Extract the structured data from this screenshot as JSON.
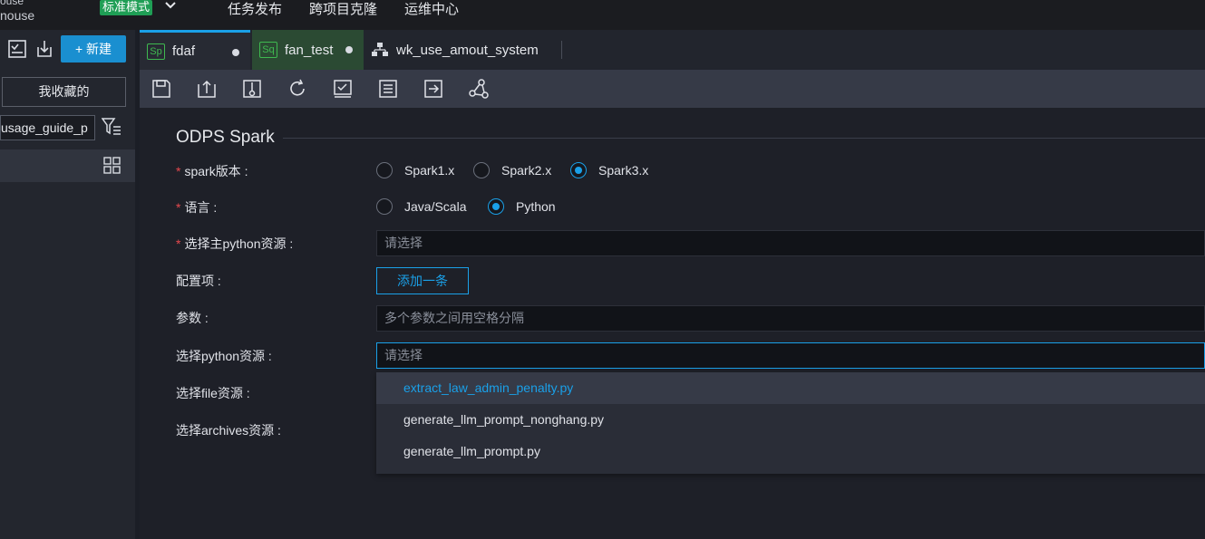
{
  "header": {
    "workspace_partial_top": "ouse",
    "workspace_partial": "nouse",
    "mode_badge": "标准模式",
    "nav": [
      "任务发布",
      "跨项目克隆",
      "运维中心"
    ]
  },
  "sidebar": {
    "new_button": "+ 新建",
    "favorites_button": "我收藏的",
    "search_value": "usage_guide_p"
  },
  "tabs": [
    {
      "tag": "Sp",
      "label": "fdaf"
    },
    {
      "tag": "Sq",
      "label": "fan_test"
    },
    {
      "label": "wk_use_amout_system"
    }
  ],
  "form": {
    "section_title": "ODPS Spark",
    "spark_version_label": "spark版本 :",
    "spark_versions": [
      "Spark1.x",
      "Spark2.x",
      "Spark3.x"
    ],
    "spark_selected": "Spark3.x",
    "language_label": "语言 :",
    "languages": [
      "Java/Scala",
      "Python"
    ],
    "language_selected": "Python",
    "main_resource_label": "选择主python资源 :",
    "main_resource_placeholder": "请选择",
    "config_label": "配置项 :",
    "add_button": "添加一条",
    "params_label": "参数 :",
    "params_placeholder": "多个参数之间用空格分隔",
    "python_resource_label": "选择python资源 :",
    "python_resource_placeholder": "请选择",
    "file_resource_label": "选择file资源 :",
    "archives_resource_label": "选择archives资源 :"
  },
  "dropdown_options": [
    "extract_law_admin_penalty.py",
    "generate_llm_prompt_nonghang.py",
    "generate_llm_prompt.py"
  ],
  "colors": {
    "accent": "#1aa0e8",
    "badge": "#1f9e55",
    "required": "#e5484d"
  }
}
